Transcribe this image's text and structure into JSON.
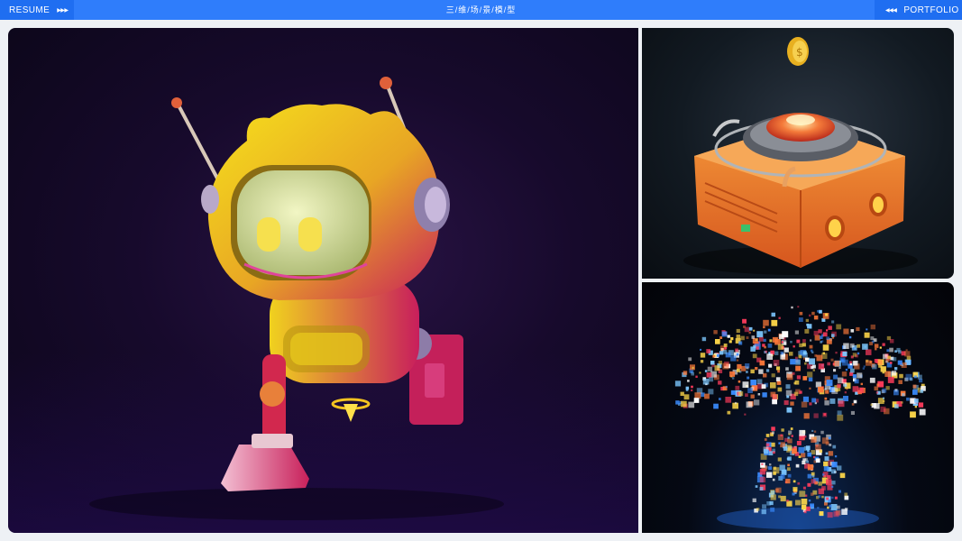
{
  "nav": {
    "left_label": "RESUME",
    "left_arrows": "▶▶▶",
    "title": "三/维/场/景/模/型",
    "right_arrows": "◀◀◀",
    "right_label": "PORTFOLIO"
  },
  "colors": {
    "topbar": "#2f7dfb",
    "nav_button": "#1f6ef1",
    "page_background": "#eef1f5"
  },
  "gallery": {
    "main_render": {
      "subject": "robot-character"
    },
    "top_right_render": {
      "subject": "orange-coin-machine"
    },
    "bottom_right_render": {
      "subject": "voxel-neon-tree"
    }
  }
}
